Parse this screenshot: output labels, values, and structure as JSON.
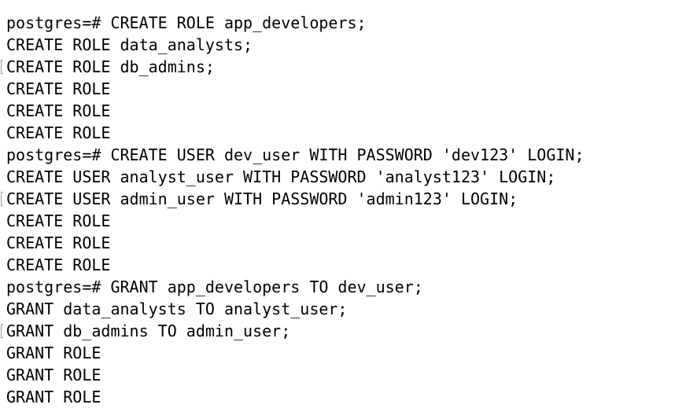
{
  "terminal": {
    "lines": [
      {
        "text": "postgres=# CREATE ROLE app_developers;",
        "marker": false
      },
      {
        "text": "CREATE ROLE data_analysts;",
        "marker": false
      },
      {
        "text": "CREATE ROLE db_admins;",
        "marker": true
      },
      {
        "text": "CREATE ROLE",
        "marker": false
      },
      {
        "text": "CREATE ROLE",
        "marker": false
      },
      {
        "text": "CREATE ROLE",
        "marker": false
      },
      {
        "text": "postgres=# CREATE USER dev_user WITH PASSWORD 'dev123' LOGIN;",
        "marker": false
      },
      {
        "text": "CREATE USER analyst_user WITH PASSWORD 'analyst123' LOGIN;",
        "marker": false
      },
      {
        "text": "CREATE USER admin_user WITH PASSWORD 'admin123' LOGIN;",
        "marker": true
      },
      {
        "text": "CREATE ROLE",
        "marker": false
      },
      {
        "text": "CREATE ROLE",
        "marker": false
      },
      {
        "text": "CREATE ROLE",
        "marker": false
      },
      {
        "text": "postgres=# GRANT app_developers TO dev_user;",
        "marker": false
      },
      {
        "text": "GRANT data_analysts TO analyst_user;",
        "marker": false
      },
      {
        "text": "GRANT db_admins TO admin_user;",
        "marker": true
      },
      {
        "text": "GRANT ROLE",
        "marker": false
      },
      {
        "text": "GRANT ROLE",
        "marker": false
      },
      {
        "text": "GRANT ROLE",
        "marker": false
      }
    ]
  }
}
